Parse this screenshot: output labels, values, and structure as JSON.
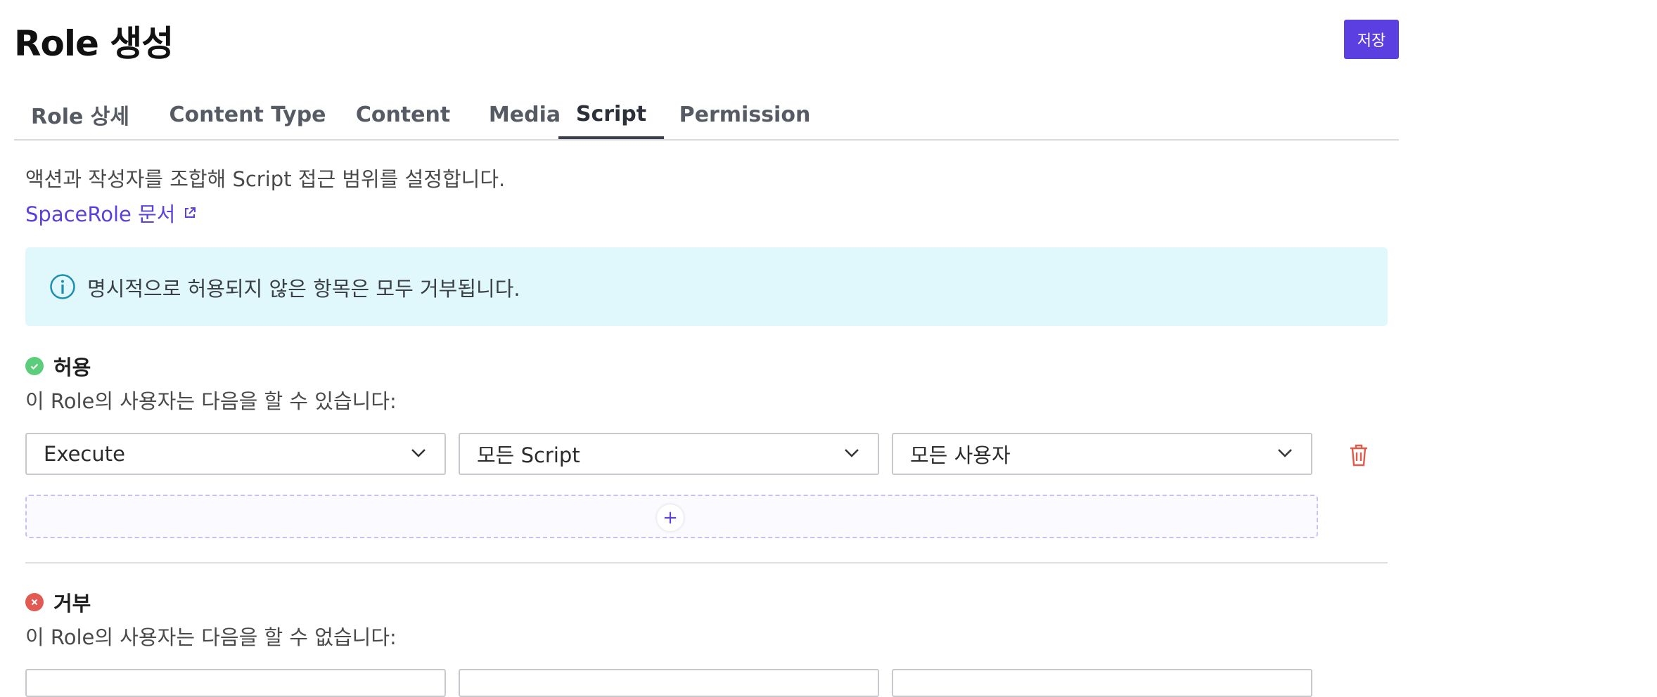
{
  "page": {
    "title": "Role 생성",
    "save_label": "저장"
  },
  "tabs": [
    {
      "label": "Role 상세"
    },
    {
      "label": "Content Type"
    },
    {
      "label": "Content"
    },
    {
      "label": "Media"
    },
    {
      "label": "Script",
      "active": true
    },
    {
      "label": "Permission"
    }
  ],
  "description": "액션과 작성자를 조합해 Script 접근 범위를 설정합니다.",
  "doc_link": {
    "label": "SpaceRole 문서",
    "icon": "external-link-icon"
  },
  "info": {
    "text": "명시적으로 허용되지 않은 항목은 모두 거부됩니다.",
    "icon": "info-icon"
  },
  "allow": {
    "title": "허용",
    "subtitle": "이 Role의 사용자는 다음을 할 수 있습니다:",
    "color": "#5ccd7a",
    "rule": {
      "action": "Execute",
      "target": "모든 Script",
      "author": "모든 사용자"
    },
    "add_label": "+"
  },
  "deny": {
    "title": "거부",
    "subtitle": "이 Role의 사용자는 다음을 할 수 없습니다:",
    "color": "#e25a52"
  },
  "colors": {
    "accent": "#5b3fe0",
    "info_bg": "#e0f7fb",
    "trash": "#e05b4b"
  }
}
